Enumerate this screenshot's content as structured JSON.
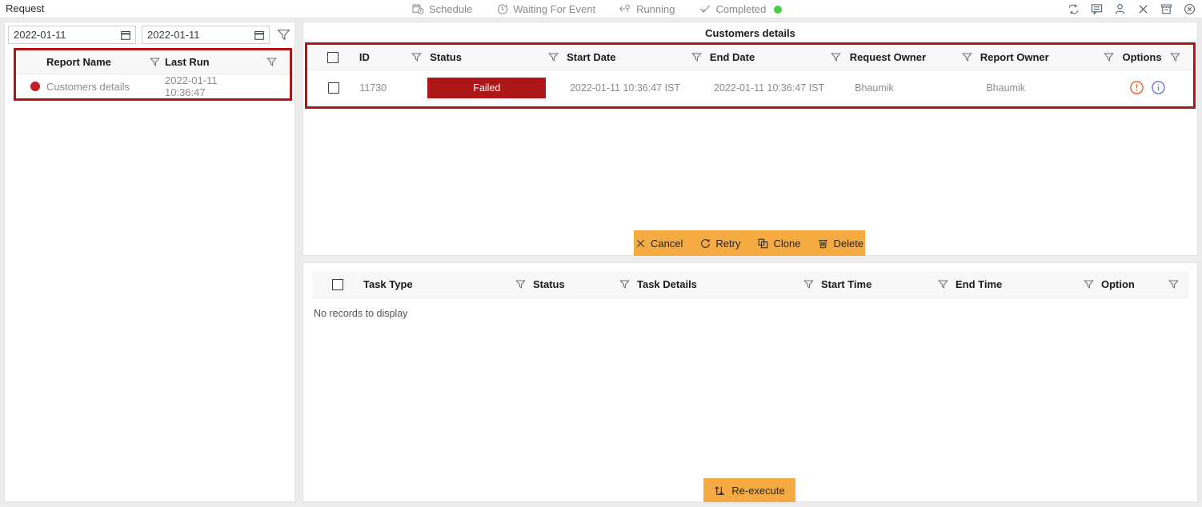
{
  "window": {
    "title": "Request",
    "status_tabs": [
      {
        "label": "Schedule",
        "icon": "calendar-clock-icon"
      },
      {
        "label": "Waiting For Event",
        "icon": "stopwatch-icon"
      },
      {
        "label": "Running",
        "icon": "running-arrow-icon"
      },
      {
        "label": "Completed",
        "icon": "check-icon"
      }
    ],
    "completed_indicator_color": "#49cc49",
    "control_icons": [
      "refresh-icon",
      "comment-icon",
      "user-icon",
      "close-icon",
      "archive-icon",
      "cancel-circle-icon"
    ]
  },
  "left_panel": {
    "date_from": {
      "value": "2022-01-11",
      "icon": "calendar-icon"
    },
    "date_to": {
      "value": "2022-01-11",
      "icon": "calendar-icon"
    },
    "filter_icon": "funnel-icon",
    "highlight_color": "#b21414",
    "table": {
      "columns": [
        "Report Name",
        "Last Run"
      ],
      "rows": [
        {
          "status_dot_color": "#c32020",
          "report_name": "Customers details",
          "last_run": "2022-01-11 10:36:47"
        }
      ]
    }
  },
  "requests_panel": {
    "title": "Customers details",
    "highlight_color": "#b21414",
    "columns": [
      "ID",
      "Status",
      "Start Date",
      "End Date",
      "Request Owner",
      "Report Owner",
      "Options"
    ],
    "rows": [
      {
        "id": "11730",
        "status": "Failed",
        "status_color": "#ad1717",
        "start_date": "2022-01-11 10:36:47 IST",
        "end_date": "2022-01-11 10:36:47 IST",
        "request_owner": "Bhaumik",
        "report_owner": "Bhaumik",
        "option_icons": [
          "warning-circle-icon",
          "info-circle-icon"
        ]
      }
    ],
    "actions": {
      "bar_color": "#f5aa42",
      "buttons": [
        {
          "label": "Cancel",
          "icon": "x-icon"
        },
        {
          "label": "Retry",
          "icon": "refresh-arrow-icon"
        },
        {
          "label": "Clone",
          "icon": "copy-icon"
        },
        {
          "label": "Delete",
          "icon": "trash-icon"
        }
      ]
    }
  },
  "tasks_panel": {
    "columns": [
      "Task Type",
      "Status",
      "Task Details",
      "Start Time",
      "End Time",
      "Option"
    ],
    "empty_message": "No records to display",
    "reexecute": {
      "label": "Re-execute",
      "icon": "re-execute-icon",
      "color": "#f5aa42"
    }
  }
}
